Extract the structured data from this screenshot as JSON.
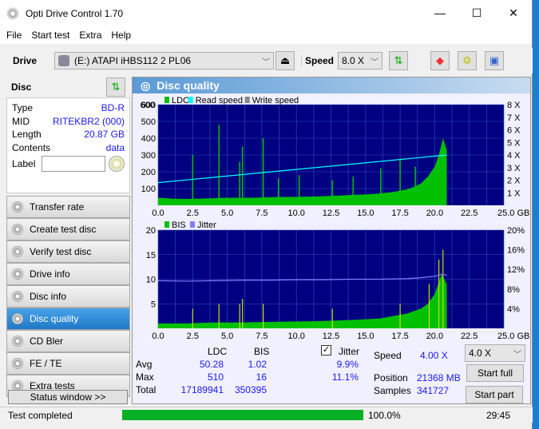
{
  "title": "Opti Drive Control 1.70",
  "window_buttons": [
    "—",
    "☐",
    "✕"
  ],
  "menu": [
    "File",
    "Start test",
    "Extra",
    "Help"
  ],
  "toolbar": {
    "drive_label": "Drive",
    "drive_value": "(E:)   ATAPI iHBS112   2 PL06",
    "speed_label": "Speed",
    "speed_value": "8.0 X"
  },
  "disc": {
    "header": "Disc",
    "rows": [
      {
        "k": "Type",
        "v": "BD-R"
      },
      {
        "k": "MID",
        "v": "RITEKBR2 (000)"
      },
      {
        "k": "Length",
        "v": "20.87 GB"
      },
      {
        "k": "Contents",
        "v": "data"
      }
    ],
    "label_key": "Label",
    "label_value": ""
  },
  "nav": [
    {
      "label": "Transfer rate"
    },
    {
      "label": "Create test disc"
    },
    {
      "label": "Verify test disc"
    },
    {
      "label": "Drive info"
    },
    {
      "label": "Disc info"
    },
    {
      "label": "Disc quality",
      "active": true
    },
    {
      "label": "CD Bler"
    },
    {
      "label": "FE / TE"
    },
    {
      "label": "Extra tests"
    }
  ],
  "status_window": "Status window >>",
  "panel_title": "Disc quality",
  "colors": {
    "ldc": "#00c000",
    "bis": "#00c000",
    "read": "#00ffff",
    "write": "#888888",
    "jitter": "#8080ff",
    "bg": "#000080",
    "grid": "#3050c0",
    "accent": "#1a1aff",
    "progress": "#06b025"
  },
  "chart_data": [
    {
      "type": "area",
      "legend": [
        "LDC",
        "Read speed",
        "Write speed"
      ],
      "legend_placement": "top-left",
      "xlim": [
        0,
        25
      ],
      "ylim": [
        0,
        600
      ],
      "y2lim": [
        0,
        8
      ],
      "xticks": [
        "0.0",
        "2.5",
        "5.0",
        "7.5",
        "10.0",
        "12.5",
        "15.0",
        "17.5",
        "20.0",
        "22.5",
        "25.0 GB"
      ],
      "yticks": [
        "100",
        "200",
        "300",
        "400",
        "500",
        "600"
      ],
      "y2ticks": [
        "1 X",
        "2 X",
        "3 X",
        "4 X",
        "5 X",
        "6 X",
        "7 X",
        "8 X"
      ],
      "ldc": {
        "x": [
          0,
          1,
          2,
          3,
          4,
          5,
          6,
          7,
          8,
          9,
          10,
          11,
          12,
          13,
          14,
          15,
          16,
          17,
          18,
          18.5,
          19,
          19.5,
          20,
          20.3,
          20.6,
          20.87
        ],
        "y": [
          45,
          40,
          38,
          40,
          42,
          45,
          45,
          45,
          48,
          50,
          50,
          52,
          55,
          58,
          62,
          65,
          70,
          80,
          95,
          110,
          130,
          170,
          230,
          300,
          400,
          330
        ]
      },
      "ldc_spikes": {
        "x": [
          2.5,
          4.4,
          5.9,
          6.1,
          7.6,
          8.7,
          10.2,
          12.6,
          14.1,
          16.1,
          17.5,
          18.6
        ],
        "y": [
          300,
          480,
          260,
          350,
          400,
          160,
          180,
          150,
          170,
          220,
          280,
          230
        ]
      },
      "read_speed": {
        "x": [
          0,
          20.87
        ],
        "y": [
          1.8,
          4.0
        ]
      }
    },
    {
      "type": "area",
      "legend": [
        "BIS",
        "Jitter"
      ],
      "legend_placement": "top-left",
      "xlim": [
        0,
        25
      ],
      "ylim": [
        0,
        20
      ],
      "y2lim": [
        0,
        20
      ],
      "xticks": [
        "0.0",
        "2.5",
        "5.0",
        "7.5",
        "10.0",
        "12.5",
        "15.0",
        "17.5",
        "20.0",
        "22.5",
        "25.0 GB"
      ],
      "yticks": [
        "5",
        "10",
        "15",
        "20"
      ],
      "y2ticks": [
        "4%",
        "8%",
        "12%",
        "16%",
        "20%"
      ],
      "bis": {
        "x": [
          0,
          2,
          4,
          6,
          8,
          10,
          12,
          14,
          16,
          17,
          18,
          19,
          19.5,
          20,
          20.5,
          20.87
        ],
        "y": [
          1,
          1,
          1.2,
          1.2,
          1.3,
          1.4,
          1.5,
          1.7,
          2,
          2.5,
          3,
          4,
          5,
          7,
          11,
          9
        ]
      },
      "jitter": {
        "x": [
          0,
          2,
          4,
          6,
          8,
          10,
          12,
          14,
          16,
          18,
          19,
          20,
          20.5,
          20.87
        ],
        "y": [
          9.7,
          9.6,
          9.7,
          9.8,
          9.8,
          9.9,
          9.9,
          10,
          10,
          10.1,
          10.3,
          10.6,
          11,
          10.8
        ]
      }
    }
  ],
  "stats": {
    "col_ldc": "LDC",
    "col_bis": "BIS",
    "jitter_label": "Jitter",
    "jitter_checked": true,
    "rows": [
      {
        "k": "Avg",
        "ldc": "50.28",
        "bis": "1.02",
        "jit": "9.9%"
      },
      {
        "k": "Max",
        "ldc": "510",
        "bis": "16",
        "jit": "11.1%"
      },
      {
        "k": "Total",
        "ldc": "17189941",
        "bis": "350395",
        "jit": ""
      }
    ],
    "speed_label": "Speed",
    "speed_value": "4.00 X",
    "position_label": "Position",
    "position_value": "21368 MB",
    "samples_label": "Samples",
    "samples_value": "341727",
    "speed_select": "4.0 X",
    "start_full": "Start full",
    "start_part": "Start part"
  },
  "statusbar": {
    "text": "Test completed",
    "progress": 100,
    "progress_text": "100.0%",
    "time": "29:45"
  }
}
